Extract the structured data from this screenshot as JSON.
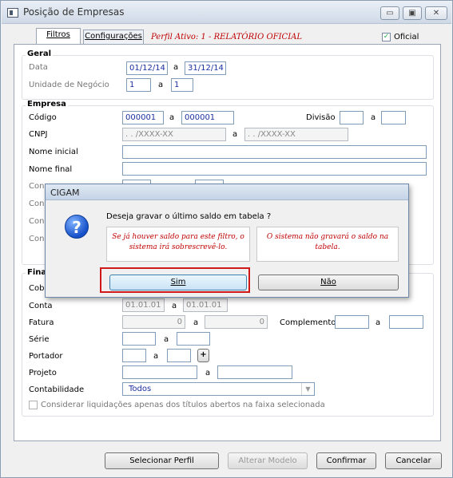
{
  "window": {
    "title": "Posição de Empresas",
    "minimize": "▭",
    "maximize": "▣",
    "close": "✕"
  },
  "tabs": [
    {
      "label": "Filtros"
    },
    {
      "label": "Configurações"
    }
  ],
  "perfil_ativo": "Perfil Ativo: 1 - RELATÓRIO OFICIAL",
  "oficial": {
    "label": "Oficial",
    "checked": "✓"
  },
  "geral": {
    "title": "Geral",
    "data_label": "Data",
    "data_from": "01/12/14",
    "a": "a",
    "data_to": "31/12/14",
    "unidade_label": "Unidade de Negócio",
    "unidade_from": "1",
    "unidade_to": "1"
  },
  "empresa": {
    "title": "Empresa",
    "codigo_label": "Código",
    "codigo_from": "000001",
    "codigo_to": "000001",
    "divisao_label": "Divisão",
    "cnpj_label": "CNPJ",
    "cnpj_from": ".  .   /XXXX-XX",
    "cnpj_to": ".  .   /XXXX-XX",
    "nome_inicial_label": "Nome inicial",
    "nome_final_label": "Nome final",
    "hidden_labels": [
      "Con",
      "Con",
      "Con",
      "Con"
    ]
  },
  "financeiro": {
    "title_partial": "Fina",
    "cob_label": "Cob",
    "conta_label": "Conta",
    "conta_from": "01.01.01",
    "conta_to": "01.01.01",
    "fatura_label": "Fatura",
    "fatura_from": "0",
    "fatura_to": "0",
    "complemento_label": "Complemento",
    "serie_label": "Série",
    "portador_label": "Portador",
    "portador_add": "+",
    "projeto_label": "Projeto",
    "contabilidade_label": "Contabilidade",
    "contabilidade_value": "Todos",
    "dropdown_arrow": "▼",
    "considerar_label": "Considerar liquidações apenas dos títulos abertos na faixa selecionada"
  },
  "footer": {
    "selecionar": "Selecionar Perfil",
    "alterar": "Alterar Modelo",
    "confirmar": "Confirmar",
    "cancelar": "Cancelar"
  },
  "dialog": {
    "title": "CIGAM",
    "icon": "?",
    "question": "Deseja gravar o último saldo em tabela ?",
    "note_sim": "Se já houver saldo para este filtro, o sistema irá sobrescrevê-lo.",
    "note_nao": "O sistema não gravará o saldo na tabela.",
    "sim": "Sim",
    "nao": "Não"
  }
}
